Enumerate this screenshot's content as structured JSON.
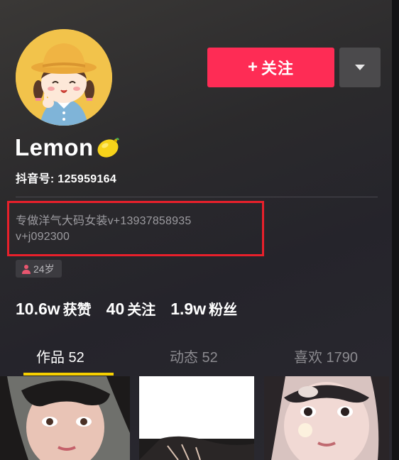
{
  "profile": {
    "name": "Lemon",
    "name_emoji_icon": "lemon-icon",
    "douyin_id_label": "抖音号: 125959164",
    "bio_line_1": "专做洋气大码女装v+13937858935",
    "bio_line_2": "v+j092300",
    "age": "24岁",
    "avatar_icon": "cartoon-girl-avatar"
  },
  "actions": {
    "follow_plus": "+",
    "follow_label": "关注",
    "more_icon": "triangle-down-icon"
  },
  "stats": [
    {
      "value": "10.6w",
      "label": "获赞"
    },
    {
      "value": "40",
      "label": "关注"
    },
    {
      "value": "1.9w",
      "label": "粉丝"
    }
  ],
  "tabs": [
    {
      "label": "作品 52",
      "active": true
    },
    {
      "label": "动态 52",
      "active": false
    },
    {
      "label": "喜欢 1790",
      "active": false
    }
  ],
  "colors": {
    "follow_button": "#fe2c55",
    "tab_underline": "#f7d000",
    "highlight_box": "#e8202b"
  }
}
